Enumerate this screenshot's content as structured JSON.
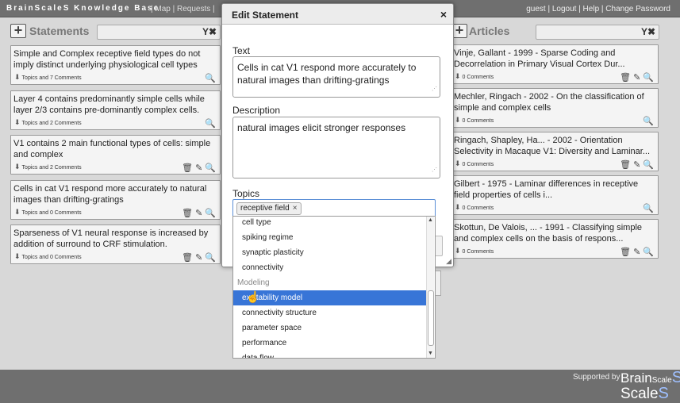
{
  "app": {
    "title": "BrainScaleS Knowledge Base",
    "sublinks": "| Map | Requests |",
    "userlinks": "guest | Logout | Help | Change Password"
  },
  "statements": {
    "title": "Statements",
    "add": "+",
    "filter_icons": "Y✖",
    "items": [
      {
        "text": "Simple and Complex receptive field types do not imply distinct underlying physiological cell types",
        "meta": "Topics and 7 Comments"
      },
      {
        "text": "Layer 4 contains predominantly simple cells while layer 2/3 contains pre-dominantly complex cells.",
        "meta": "Topics and 2 Comments"
      },
      {
        "text": "V1 contains 2 main functional types of cells: simple and complex",
        "meta": "Topics and 2 Comments"
      },
      {
        "text": "Cells in cat V1 respond more accurately to natural images than drifting-gratings",
        "meta": "Topics and 0 Comments"
      },
      {
        "text": "Sparseness of V1 neural response is increased by addition of surround to CRF stimulation.",
        "meta": "Topics and 0 Comments"
      }
    ]
  },
  "articles": {
    "title": "Articles",
    "add": "+",
    "filter_icons": "Y✖",
    "items": [
      {
        "text": "Vinje, Gallant - 1999 - Sparse Coding and Decorrelation in Primary Visual Cortex Dur...",
        "meta": "0 Comments"
      },
      {
        "text": "Mechler, Ringach - 2002 - On the classification of simple and complex cells",
        "meta": "0 Comments"
      },
      {
        "text": "Ringach, Shapley, Ha... - 2002 - Orientation Selectivity in Macaque V1: Diversity and Laminar...",
        "meta": "0 Comments"
      },
      {
        "text": "Gilbert - 1975 - Laminar differences in receptive field properties of cells i...",
        "meta": "0 Comments"
      },
      {
        "text": "Skottun, De Valois, ... - 1991 - Classifying simple and complex cells on the basis of respons...",
        "meta": "0 Comments"
      }
    ]
  },
  "icons": {
    "arrow": "down-arrow-icon",
    "search": "🔍",
    "trash": "🗑",
    "edit": "✎",
    "vote": "⬇"
  },
  "dialog": {
    "title": "Edit Statement",
    "close": "×",
    "text_label": "Text",
    "text_value": "Cells in cat V1 respond more accurately to natural images than drifting-gratings",
    "description_label": "Description",
    "description_value": "natural images elicit stronger responses",
    "topics_label": "Topics",
    "selected_topic": "receptive field",
    "tag_remove": "×"
  },
  "dropdown": {
    "items": [
      {
        "label": "cell type",
        "kind": "item"
      },
      {
        "label": "spiking regime",
        "kind": "item"
      },
      {
        "label": "synaptic plasticity",
        "kind": "item"
      },
      {
        "label": "connectivity",
        "kind": "item"
      },
      {
        "label": "Modeling",
        "kind": "group"
      },
      {
        "label": "excitability model",
        "kind": "item",
        "highlighted": true
      },
      {
        "label": "connectivity structure",
        "kind": "item"
      },
      {
        "label": "parameter space",
        "kind": "item"
      },
      {
        "label": "performance",
        "kind": "item"
      },
      {
        "label": "data flow",
        "kind": "item"
      }
    ]
  },
  "footer": {
    "supported": "Supported by",
    "logo_brain": "Brain",
    "logo_scale_small": "Scale",
    "logo_s": "S",
    "logo_scale": "Scale"
  },
  "colors": {
    "highlight": "#3875d7",
    "chrome": "#6f6f6f",
    "background": "#d8d8d8"
  }
}
